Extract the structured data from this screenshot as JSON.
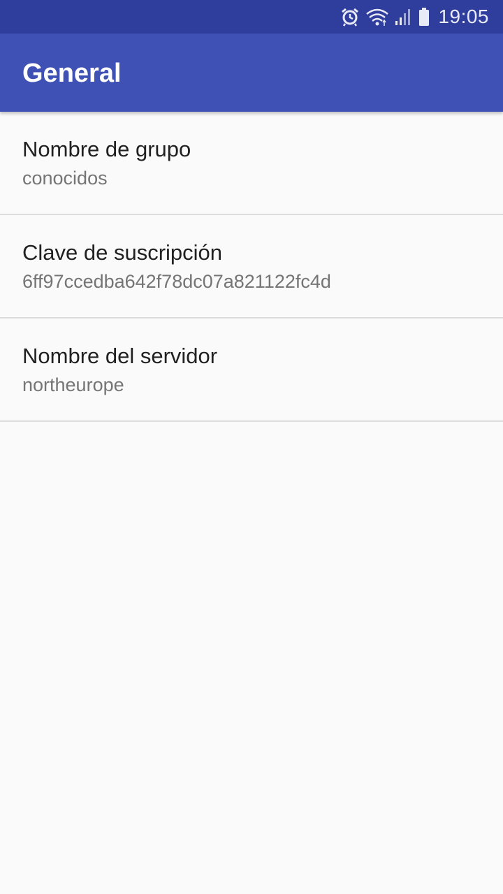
{
  "status_bar": {
    "time": "19:05",
    "icons": [
      "alarm-icon",
      "wifi-icon",
      "signal-icon",
      "battery-icon"
    ]
  },
  "app_bar": {
    "title": "General"
  },
  "preferences": [
    {
      "title": "Nombre de grupo",
      "summary": "conocidos"
    },
    {
      "title": "Clave de suscripción",
      "summary": "6ff97ccedba642f78dc07a821122fc4d"
    },
    {
      "title": "Nombre del servidor",
      "summary": "northeurope"
    }
  ],
  "colors": {
    "status_bar": "#2f3d9c",
    "app_bar": "#3f51b5",
    "background": "#fafafa",
    "title_text": "#212121",
    "summary_text": "#757575"
  }
}
